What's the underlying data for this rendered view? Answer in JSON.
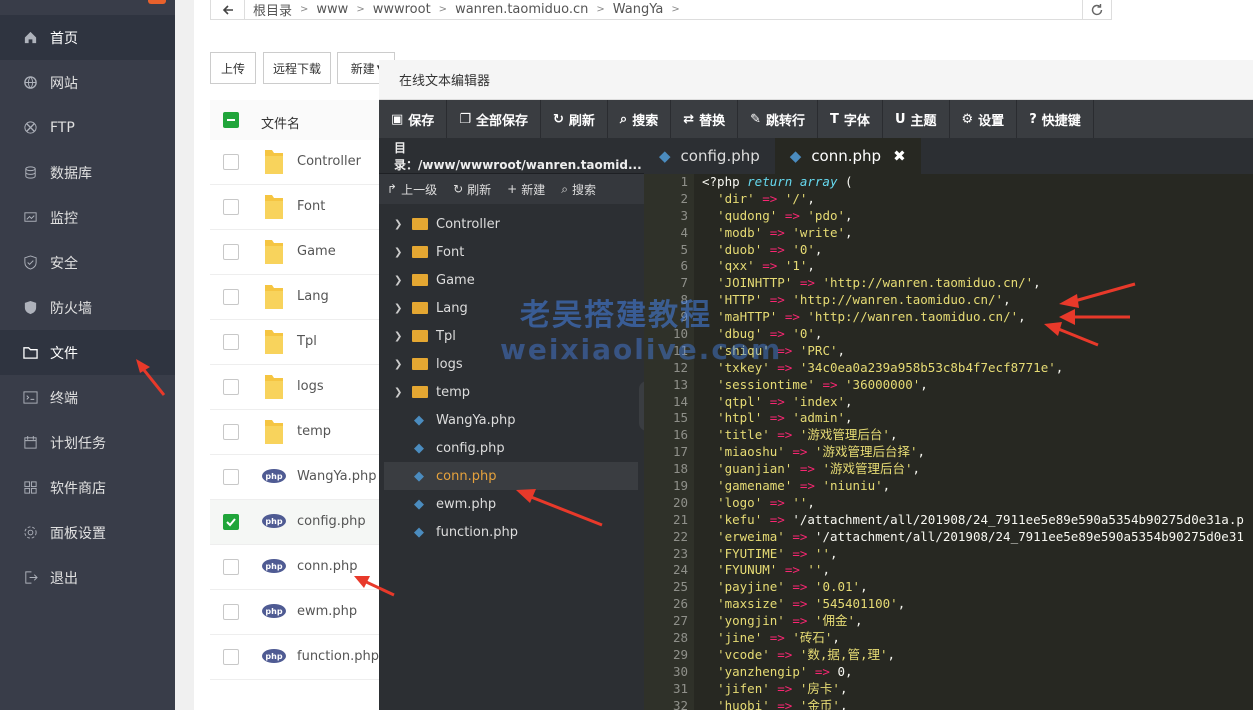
{
  "sidebar": {
    "items": [
      {
        "label": "首页",
        "icon": "home-icon"
      },
      {
        "label": "网站",
        "icon": "globe-icon"
      },
      {
        "label": "FTP",
        "icon": "ftp-icon"
      },
      {
        "label": "数据库",
        "icon": "database-icon"
      },
      {
        "label": "监控",
        "icon": "monitor-icon"
      },
      {
        "label": "安全",
        "icon": "shield-icon"
      },
      {
        "label": "防火墙",
        "icon": "firewall-icon"
      },
      {
        "label": "文件",
        "icon": "folder-icon"
      },
      {
        "label": "终端",
        "icon": "terminal-icon"
      },
      {
        "label": "计划任务",
        "icon": "calendar-icon"
      },
      {
        "label": "软件商店",
        "icon": "apps-icon"
      },
      {
        "label": "面板设置",
        "icon": "gear-icon"
      },
      {
        "label": "退出",
        "icon": "logout-icon"
      }
    ]
  },
  "path": {
    "segments": [
      "根目录",
      "www",
      "wwwroot",
      "wanren.taomiduo.cn",
      "WangYa"
    ]
  },
  "toolbar": {
    "upload": "上传",
    "remote_download": "远程下载",
    "new": "新建"
  },
  "filelist": {
    "header": "文件名",
    "files": [
      {
        "name": "Controller",
        "type": "folder"
      },
      {
        "name": "Font",
        "type": "folder"
      },
      {
        "name": "Game",
        "type": "folder"
      },
      {
        "name": "Lang",
        "type": "folder"
      },
      {
        "name": "Tpl",
        "type": "folder"
      },
      {
        "name": "logs",
        "type": "folder"
      },
      {
        "name": "temp",
        "type": "folder"
      },
      {
        "name": "WangYa.php",
        "type": "php"
      },
      {
        "name": "config.php",
        "type": "php",
        "checked": true
      },
      {
        "name": "conn.php",
        "type": "php"
      },
      {
        "name": "ewm.php",
        "type": "php"
      },
      {
        "name": "function.php",
        "type": "php"
      }
    ]
  },
  "editor": {
    "title": "在线文本编辑器",
    "tools": [
      "保存",
      "全部保存",
      "刷新",
      "搜索",
      "替换",
      "跳转行",
      "字体",
      "主题",
      "设置",
      "快捷键"
    ],
    "dir_label": "目录：/www/wwwroot/wanren.taomid...",
    "dir_tools": [
      "上一级",
      "刷新",
      "新建",
      "搜索"
    ],
    "tree": [
      {
        "name": "Controller",
        "type": "folder"
      },
      {
        "name": "Font",
        "type": "folder"
      },
      {
        "name": "Game",
        "type": "folder"
      },
      {
        "name": "Lang",
        "type": "folder"
      },
      {
        "name": "Tpl",
        "type": "folder"
      },
      {
        "name": "logs",
        "type": "folder"
      },
      {
        "name": "temp",
        "type": "folder"
      },
      {
        "name": "WangYa.php",
        "type": "file"
      },
      {
        "name": "config.php",
        "type": "file"
      },
      {
        "name": "conn.php",
        "type": "file",
        "current": true
      },
      {
        "name": "ewm.php",
        "type": "file"
      },
      {
        "name": "function.php",
        "type": "file"
      }
    ],
    "tabs": [
      {
        "label": "config.php"
      },
      {
        "label": "conn.php",
        "active": true
      }
    ],
    "code": [
      "<?php return array (",
      "  'dir' => '/',",
      "  'qudong' => 'pdo',",
      "  'modb' => 'write',",
      "  'duob' => '0',",
      "  'qxx' => '1',",
      "  'JOINHTTP' => 'http://wanren.taomiduo.cn/',",
      "  'HTTP' => 'http://wanren.taomiduo.cn/',",
      "  'maHTTP' => 'http://wanren.taomiduo.cn/',",
      "  'dbug' => '0',",
      "  'shiqu' => 'PRC',",
      "  'txkey' => '34c0ea0a239a958b53c8b4f7ecf8771e',",
      "  'sessiontime' => '36000000',",
      "  'qtpl' => 'index',",
      "  'htpl' => 'admin',",
      "  'title' => '游戏管理后台',",
      "  'miaoshu' => '游戏管理后台择',",
      "  'guanjian' => '游戏管理后台',",
      "  'gamename' => 'niuniu',",
      "  'logo' => '',",
      "  'kefu' => '/attachment/all/201908/24_7911ee5e89e590a5354b90275d0e31a.p",
      "  'erweima' => '/attachment/all/201908/24_7911ee5e89e590a5354b90275d0e31",
      "  'FYUTIME' => '',",
      "  'FYUNUM' => '',",
      "  'payjine' => '0.01',",
      "  'maxsize' => '545401100',",
      "  'yongjin' => '佣金',",
      "  'jine' => '砖石',",
      "  'vcode' => '数,据,管,理',",
      "  'yanzhengip' => 0,",
      "  'jifen' => '房卡',",
      "  'huobi' => '金币',"
    ]
  },
  "watermark": {
    "line1": "老吴搭建教程",
    "line2": "weixiaolive.com"
  }
}
